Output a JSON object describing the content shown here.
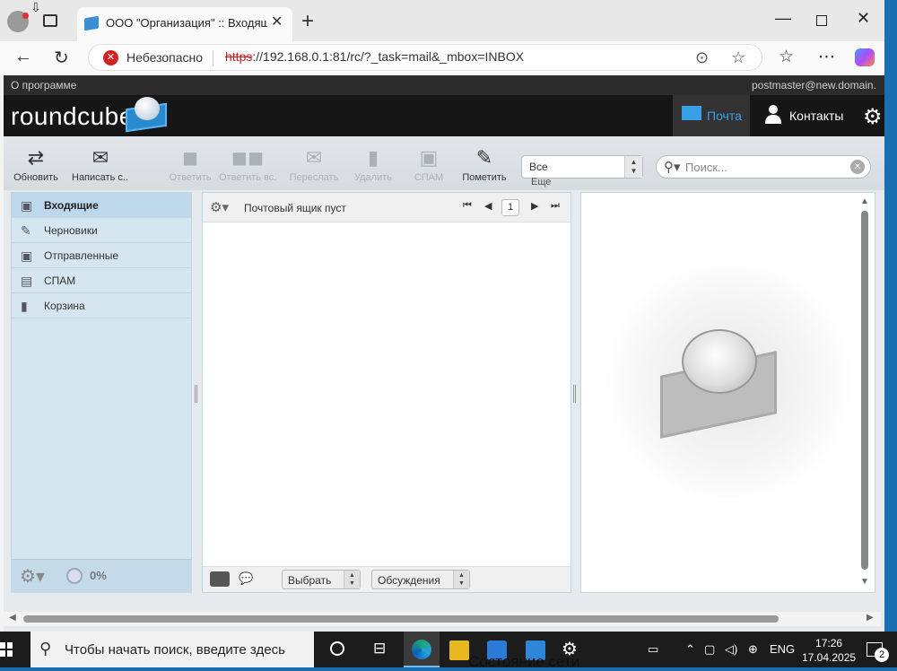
{
  "browser": {
    "tab_title": "ООО \"Организация\" :: Входящие",
    "security_label": "Небезопасно",
    "url_scheme": "https",
    "url_rest": "://192.168.0.1:81/rc/?_task=mail&_mbox=INBOX"
  },
  "app": {
    "about": "О программе",
    "user": "postmaster@new.domain.",
    "logo": "roundcube",
    "nav": {
      "mail": "Почта",
      "contacts": "Контакты"
    }
  },
  "toolbar": {
    "buttons": [
      {
        "label": "Обновить",
        "icon": "refresh-icon",
        "enabled": true
      },
      {
        "label": "Написать с...",
        "icon": "compose-icon",
        "enabled": true
      },
      {
        "label": "Ответить",
        "icon": "reply-icon",
        "enabled": false
      },
      {
        "label": "Ответить вс...",
        "icon": "reply-all-icon",
        "enabled": false
      },
      {
        "label": "Переслать",
        "icon": "forward-icon",
        "enabled": false
      },
      {
        "label": "Удалить",
        "icon": "delete-icon",
        "enabled": false
      },
      {
        "label": "СПАМ",
        "icon": "spam-icon",
        "enabled": false
      },
      {
        "label": "Пометить",
        "icon": "mark-icon",
        "enabled": true
      }
    ],
    "filter_value": "Все",
    "more_label": "Еще",
    "search_placeholder": "Поиск..."
  },
  "folders": {
    "items": [
      {
        "label": "Входящие",
        "icon": "inbox-icon",
        "active": true
      },
      {
        "label": "Черновики",
        "icon": "drafts-icon",
        "active": false
      },
      {
        "label": "Отправленные",
        "icon": "sent-icon",
        "active": false
      },
      {
        "label": "СПАМ",
        "icon": "spam-folder-icon",
        "active": false
      },
      {
        "label": "Корзина",
        "icon": "trash-icon",
        "active": false
      }
    ],
    "quota": "0%"
  },
  "messagelist": {
    "status": "Почтовый ящик пуст",
    "page": "1",
    "select_label": "Выбрать",
    "threads_label": "Обсуждения"
  },
  "taskbar": {
    "search_text": "Чтобы начать поиск, введите здесь",
    "lang": "ENG",
    "time": "17:26",
    "date": "17.04.2025",
    "overlay": "Состояние сети",
    "notifications": "2"
  },
  "colors": {
    "accent": "#3aa0e8",
    "header_bg": "#161616",
    "folders_bg": "#d5e6f1",
    "active_folder": "#bcd8ea",
    "insecure_red": "#d32020"
  }
}
